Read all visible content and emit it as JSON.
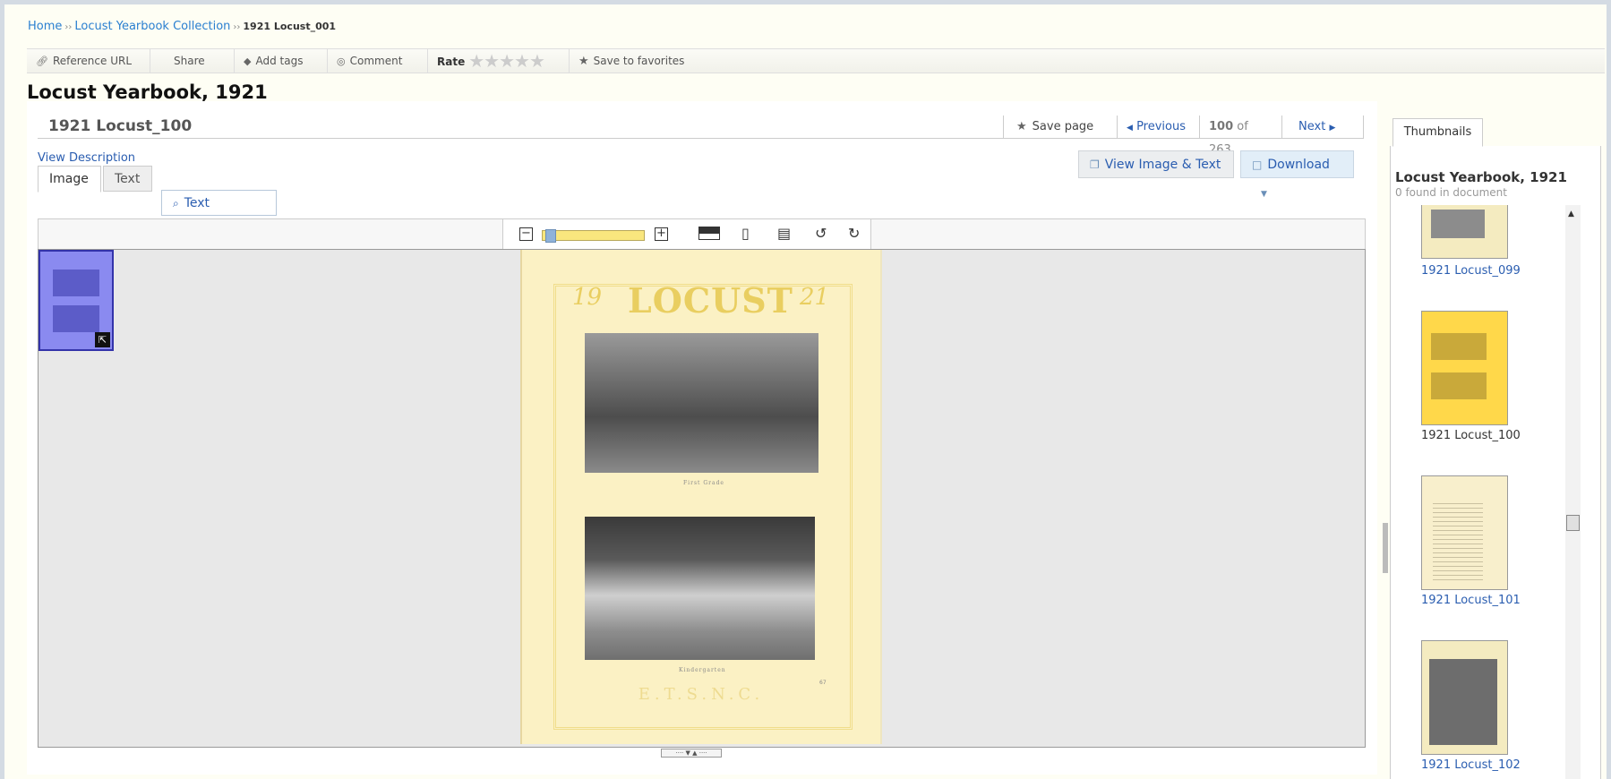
{
  "breadcrumb": {
    "home": "Home",
    "sep1": "››",
    "collection": "Locust Yearbook Collection",
    "sep2": "››",
    "current": "1921 Locust_001"
  },
  "actions": {
    "reference_url": "Reference URL",
    "share": "Share",
    "add_tags": "Add tags",
    "comment": "Comment",
    "rate": "Rate",
    "rating_stars": 0,
    "save_favorites": "Save to favorites"
  },
  "document_title": "Locust Yearbook, 1921",
  "viewer": {
    "page_name": "1921 Locust_100",
    "save_page": "Save page",
    "previous": "Previous",
    "current_page": "100",
    "of_label": "of",
    "total_pages": "263",
    "next": "Next",
    "view_description": "View Description",
    "view_image_text": "View Image & Text",
    "download": "Download",
    "tabs": {
      "image": "Image",
      "text": "Text",
      "text_search": "Text Search..."
    },
    "zoom_level": 0.05,
    "scan": {
      "year_left": "19",
      "heading": "LOCUST",
      "year_right": "21",
      "caption1": "First Grade",
      "caption2": "Kindergarten",
      "footer": "E.T.S.N.C.",
      "page_number": "67"
    }
  },
  "thumbnails": {
    "tab_label": "Thumbnails",
    "title": "Locust Yearbook, 1921",
    "found": "0 found in document",
    "items": [
      {
        "label": "1921 Locust_099",
        "current": false
      },
      {
        "label": "1921 Locust_100",
        "current": true
      },
      {
        "label": "1921 Locust_101",
        "current": false
      },
      {
        "label": "1921 Locust_102",
        "current": false
      }
    ]
  },
  "colors": {
    "link": "#2a5db0",
    "current_thumb": "#ffd84a",
    "minimap": "#8a8af0",
    "zoom_track": "#f9e67e"
  },
  "icons": [
    "link-icon",
    "tag-icon",
    "comment-icon",
    "star-icon",
    "arrow-left-icon",
    "arrow-right-icon",
    "window-icon",
    "document-icon",
    "caret-down-icon",
    "search-icon",
    "zoom-out-icon",
    "zoom-in-icon",
    "contrast-icon",
    "fit-page-icon",
    "fit-width-icon",
    "rotate-left-icon",
    "rotate-right-icon"
  ]
}
